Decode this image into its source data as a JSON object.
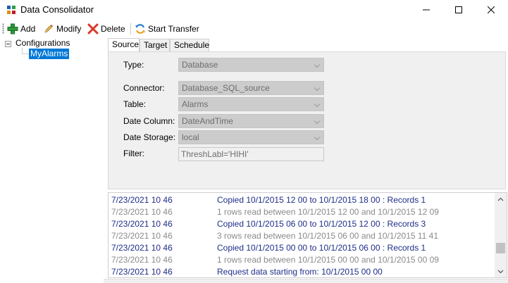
{
  "window": {
    "title": "Data Consolidator"
  },
  "toolbar": {
    "add_label": "Add",
    "modify_label": "Modify",
    "delete_label": "Delete",
    "start_transfer_label": "Start Transfer"
  },
  "tree": {
    "root_label": "Configurations",
    "child_label": "MyAlarms"
  },
  "tabs": [
    {
      "label": "Source"
    },
    {
      "label": "Target"
    },
    {
      "label": "Schedule"
    }
  ],
  "form": {
    "type": {
      "label": "Type:",
      "value": "Database"
    },
    "connector": {
      "label": "Connector:",
      "value": "Database_SQL_source"
    },
    "table": {
      "label": "Table:",
      "value": "Alarms"
    },
    "date_column": {
      "label": "Date Column:",
      "value": "DateAndTime"
    },
    "date_storage": {
      "label": "Date Storage:",
      "value": "local"
    },
    "filter": {
      "label": "Filter:",
      "value": "ThreshLabl='HIHI'"
    }
  },
  "log": [
    {
      "time": "7/23/2021 10 46",
      "message": "Copied 10/1/2015 12 00 to 10/1/2015 18 00 : Records 1",
      "style": "blue"
    },
    {
      "time": "7/23/2021 10 46",
      "message": "1 rows read between 10/1/2015 12 00 and 10/1/2015 12 09",
      "style": "gray"
    },
    {
      "time": "7/23/2021 10 46",
      "message": "Copied 10/1/2015 06 00 to 10/1/2015 12 00 : Records 3",
      "style": "blue"
    },
    {
      "time": "7/23/2021 10 46",
      "message": "3 rows read between 10/1/2015 06 00 and 10/1/2015 11 41",
      "style": "gray"
    },
    {
      "time": "7/23/2021 10 46",
      "message": "Copied 10/1/2015 00 00 to 10/1/2015 06 00 : Records 1",
      "style": "blue"
    },
    {
      "time": "7/23/2021 10 46",
      "message": "1 rows read between 10/1/2015 00 00 and 10/1/2015 00 09",
      "style": "gray"
    },
    {
      "time": "7/23/2021 10 46",
      "message": "Request data starting from: 10/1/2015 00 00",
      "style": "blue"
    }
  ],
  "colors": {
    "selection": "#0078d7",
    "log_blue": "#1f2d87",
    "log_gray": "#8a8a8a",
    "panel_bg": "#f0f0f0"
  }
}
